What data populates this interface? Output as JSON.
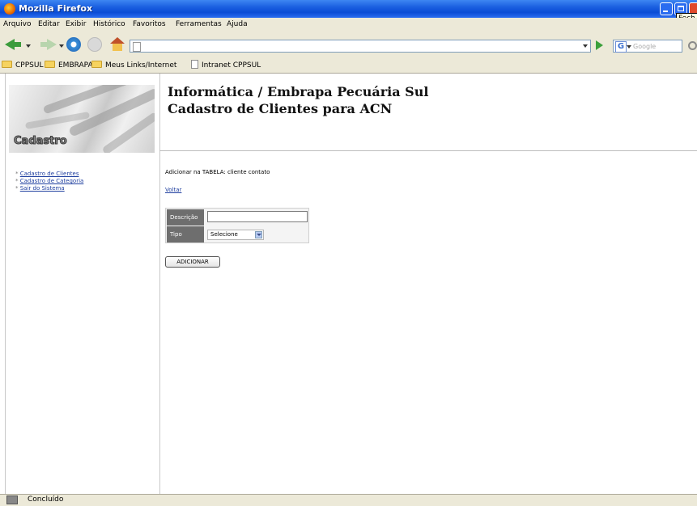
{
  "window": {
    "title": "Mozilla Firefox",
    "tooltip": "Fech"
  },
  "menu": [
    "Arquivo",
    "Editar",
    "Exibir",
    "Histórico",
    "Favoritos",
    "Ferramentas",
    "Ajuda"
  ],
  "toolbar": {
    "url": "",
    "search_placeholder": "Google"
  },
  "bookmarks": [
    "CPPSUL",
    "EMBRAPA",
    "Meus Links/Internet",
    "Intranet CPPSUL"
  ],
  "sidebar": {
    "banner_label": "Cadastro",
    "links": [
      "Cadastro de Clientes",
      "Cadastro de Categoria",
      "Sair do Sistema"
    ]
  },
  "header": {
    "line1": "Informática / Embrapa Pecuária Sul",
    "line2": "Cadastro de Clientes para ACN"
  },
  "main": {
    "note": "Adicionar na TABELA: cliente contato",
    "back_link": "Voltar",
    "form": {
      "descricao_label": "Descrição",
      "descricao_value": "",
      "tipo_label": "Tipo",
      "tipo_selected": "Selecione"
    },
    "submit_label": "ADICIONAR"
  },
  "status": "Concluído"
}
